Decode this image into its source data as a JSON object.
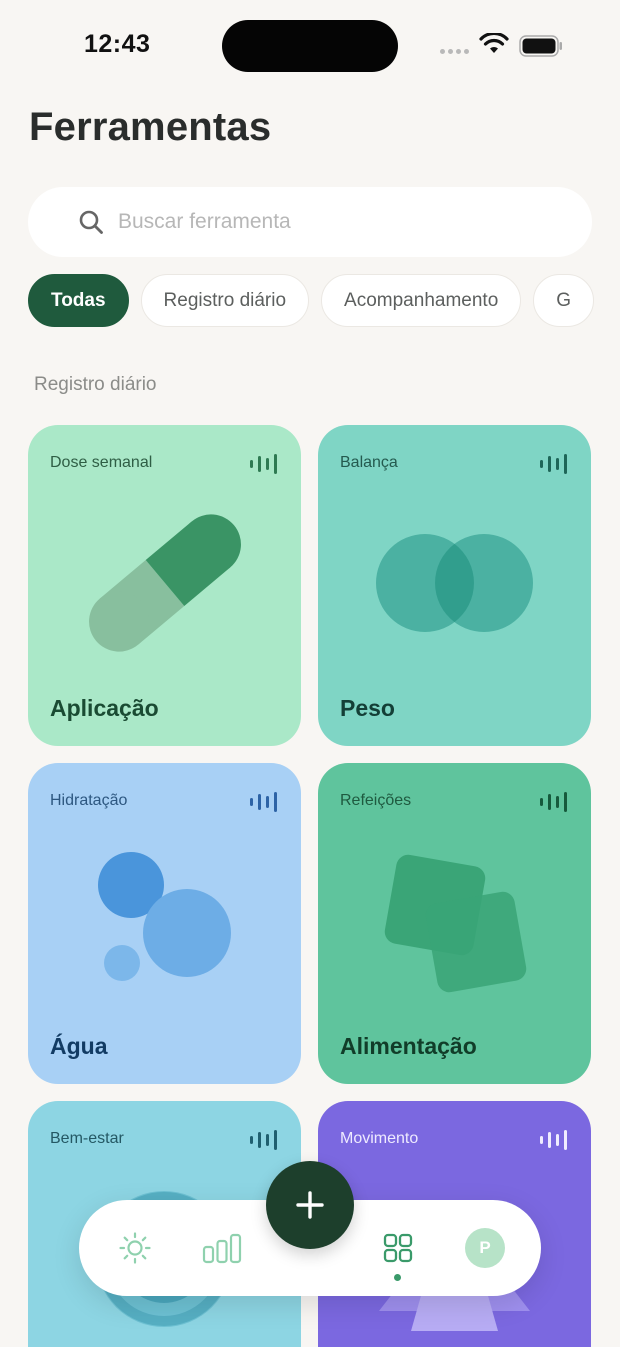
{
  "status_bar": {
    "time": "12:43"
  },
  "page": {
    "title": "Ferramentas"
  },
  "search": {
    "placeholder": "Buscar ferramenta"
  },
  "filters": [
    {
      "label": "Todas",
      "active": true
    },
    {
      "label": "Registro diário",
      "active": false
    },
    {
      "label": "Acompanhamento",
      "active": false
    },
    {
      "label": "G",
      "active": false
    }
  ],
  "section": {
    "label": "Registro diário"
  },
  "cards": [
    {
      "category": "Dose semanal",
      "title": "Aplicação",
      "icon": "capsule-icon"
    },
    {
      "category": "Balança",
      "title": "Peso",
      "icon": "overlapping-circles-icon"
    },
    {
      "category": "Hidratação",
      "title": "Água",
      "icon": "bubbles-icon"
    },
    {
      "category": "Refeições",
      "title": "Alimentação",
      "icon": "overlapping-squares-icon"
    },
    {
      "category": "Bem-estar",
      "title": "",
      "icon": "rings-icon"
    },
    {
      "category": "Movimento",
      "title": "",
      "icon": "trapezoid-icon"
    }
  ],
  "nav": {
    "items": [
      "sun-icon",
      "chart-bars-icon",
      "grid-icon",
      "avatar"
    ],
    "avatar_initial": "P",
    "active_item": "grid-icon"
  },
  "colors": {
    "accent": "#1f5a3d",
    "background": "#f8f6f3",
    "fab": "#1d3f2c"
  }
}
